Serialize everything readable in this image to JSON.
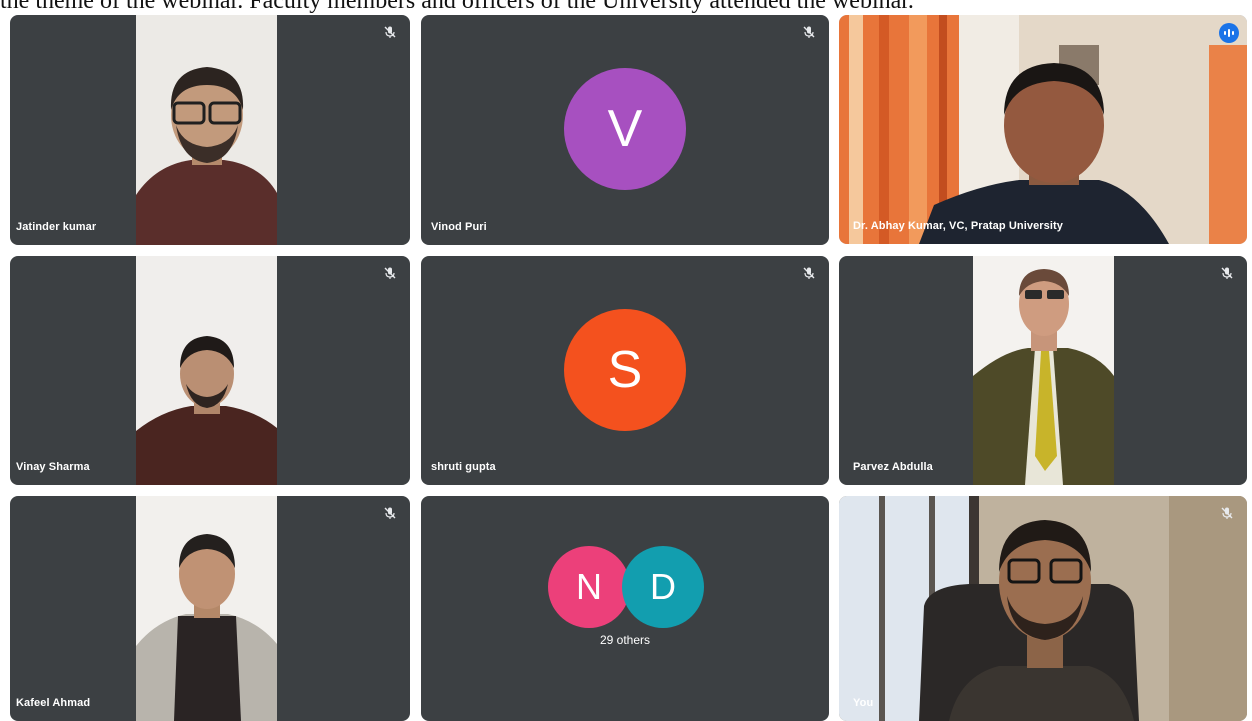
{
  "caption": "the theme of the webinar. Faculty members and officers of the University attended the webinar.",
  "meeting": {
    "participants": [
      {
        "name": "Jatinder kumar",
        "muted": true
      },
      {
        "name": "Vinod Puri",
        "muted": true,
        "initial": "V",
        "avatar_color": "#a750c0"
      },
      {
        "name": "Dr. Abhay Kumar, VC, Pratap University",
        "muted": false,
        "speaking": true
      },
      {
        "name": "Vinay Sharma",
        "muted": true
      },
      {
        "name": "shruti gupta",
        "muted": true,
        "initial": "S",
        "avatar_color": "#f4511e"
      },
      {
        "name": "Parvez Abdulla",
        "muted": true
      },
      {
        "name": "Kafeel Ahmad",
        "muted": true
      },
      {
        "name": "You",
        "muted": true
      }
    ],
    "others_tile": {
      "avatars": [
        {
          "initial": "N",
          "color": "#ec407a"
        },
        {
          "initial": "D",
          "color": "#129eaf"
        }
      ],
      "label": "29 others"
    }
  }
}
